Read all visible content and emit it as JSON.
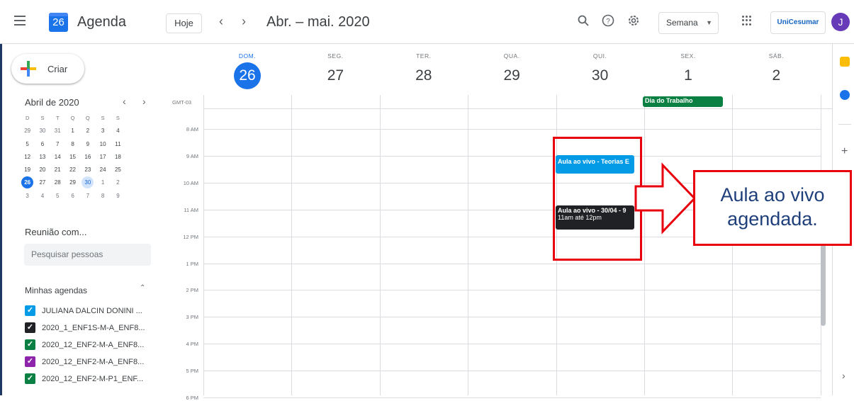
{
  "header": {
    "app_title": "Agenda",
    "logo_day": "26",
    "today_label": "Hoje",
    "prev_icon": "‹",
    "next_icon": "›",
    "date_range": "Abr. – mai. 2020",
    "view_label": "Semana",
    "org_label": "UniCesumar",
    "avatar_initial": "J"
  },
  "sidebar": {
    "create_label": "Criar",
    "mini_calendar": {
      "title": "Abril de 2020",
      "weekday_heads": [
        "D",
        "S",
        "T",
        "Q",
        "Q",
        "S",
        "S"
      ],
      "weeks": [
        [
          "29",
          "30",
          "31",
          "1",
          "2",
          "3",
          "4"
        ],
        [
          "5",
          "6",
          "7",
          "8",
          "9",
          "10",
          "11"
        ],
        [
          "12",
          "13",
          "14",
          "15",
          "16",
          "17",
          "18"
        ],
        [
          "19",
          "20",
          "21",
          "22",
          "23",
          "24",
          "25"
        ],
        [
          "26",
          "27",
          "28",
          "29",
          "30",
          "1",
          "2"
        ],
        [
          "3",
          "4",
          "5",
          "6",
          "7",
          "8",
          "9"
        ]
      ],
      "today": "26",
      "selected": "30"
    },
    "meet_title": "Reunião com...",
    "search_placeholder": "Pesquisar pessoas",
    "my_calendars_title": "Minhas agendas",
    "calendars": [
      {
        "label": "JULIANA DALCIN DONINI ...",
        "color": "#039be5"
      },
      {
        "label": "2020_1_ENF1S-M-A_ENF8...",
        "color": "#202124"
      },
      {
        "label": "2020_12_ENF2-M-A_ENF8...",
        "color": "#0b8043"
      },
      {
        "label": "2020_12_ENF2-M-A_ENF8...",
        "color": "#8e24aa"
      },
      {
        "label": "2020_12_ENF2-M-P1_ENF...",
        "color": "#0b8043"
      }
    ]
  },
  "week": {
    "timezone": "GMT-03",
    "days": [
      {
        "name": "DOM.",
        "num": "26",
        "today": true
      },
      {
        "name": "SEG.",
        "num": "27"
      },
      {
        "name": "TER.",
        "num": "28"
      },
      {
        "name": "QUA.",
        "num": "29"
      },
      {
        "name": "QUI.",
        "num": "30"
      },
      {
        "name": "SEX.",
        "num": "1"
      },
      {
        "name": "SÁB.",
        "num": "2"
      }
    ],
    "hours": [
      "8 AM",
      "9 AM",
      "10 AM",
      "11 AM",
      "12 PM",
      "1 PM",
      "2 PM",
      "3 PM",
      "4 PM",
      "5 PM",
      "6 PM"
    ]
  },
  "events": {
    "holiday": {
      "title": "Dia do Trabalho",
      "color": "#0b8043"
    },
    "event1": {
      "title": "Aula ao vivo - Teorias E",
      "color": "#039be5"
    },
    "event2": {
      "title": "Aula ao vivo - 30/04 - 9",
      "time": "11am até 12pm",
      "color": "#202124"
    }
  },
  "annotation": {
    "callout_text": "Aula ao vivo agendada.",
    "color": "#e8000d"
  }
}
